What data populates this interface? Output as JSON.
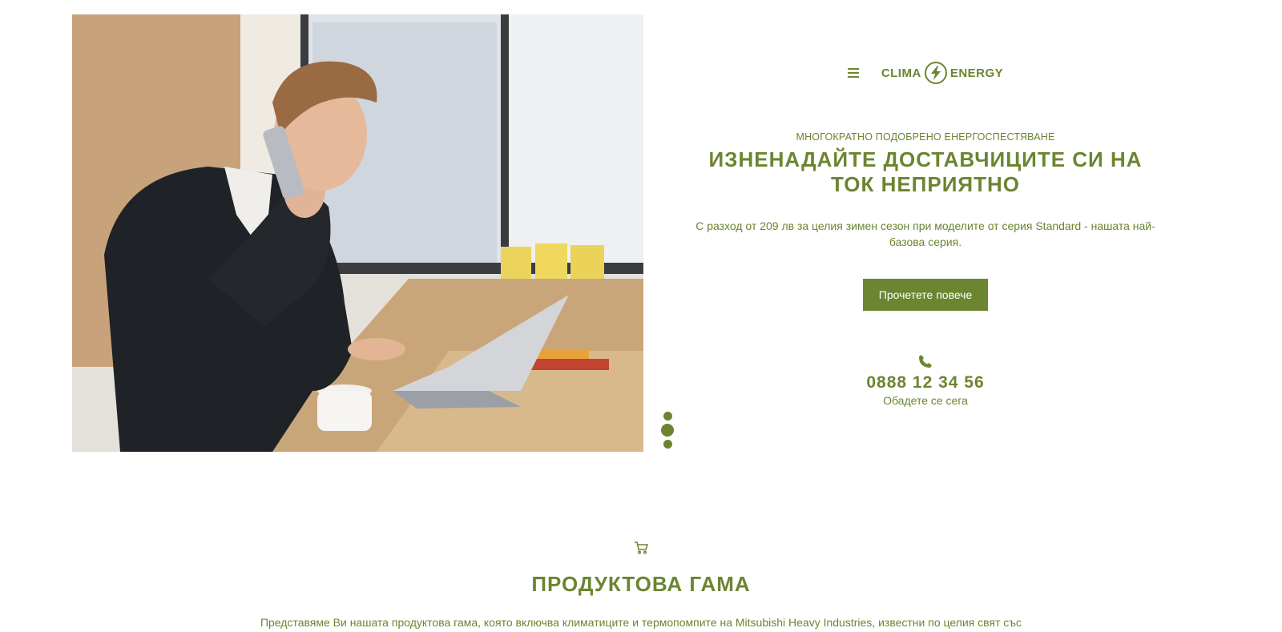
{
  "header": {
    "logo_left": "CLIMA",
    "logo_right": "ENERGY"
  },
  "hero": {
    "eyebrow": "МНОГОКРАТНО ПОДОБРЕНО ЕНЕРГОСПЕСТЯВАНЕ",
    "headline": "ИЗНЕНАДАЙТЕ ДОСТАВЧИЦИТЕ СИ НА ТОК НЕПРИЯТНО",
    "lead": "С разход от 209 лв за целия зимен сезон при моделите от серия Standard - нашата най-базова серия.",
    "cta_label": "Прочетете повече",
    "phone_number": "0888 12 34 56",
    "phone_caption": "Обадете се сега",
    "slides_count": 3,
    "active_slide": 2
  },
  "products": {
    "title": "ПРОДУКТОВА ГАМА",
    "intro": "Представяме Ви нашата продуктова гама, която включва климатиците и термопомпите на Mitsubishi Heavy Industries, известни по целия свят със"
  },
  "colors": {
    "accent": "#6b8530",
    "background": "#ffffff"
  },
  "icons": {
    "menu": "hamburger-icon",
    "logo": "lightning-bolt-icon",
    "phone": "phone-icon",
    "cart": "cart-icon"
  }
}
